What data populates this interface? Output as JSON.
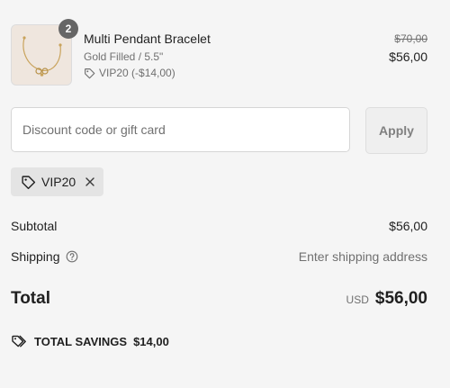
{
  "product": {
    "quantity": "2",
    "name": "Multi Pendant Bracelet",
    "variant": "Gold Filled / 5.5\"",
    "discount_line": "VIP20 (-$14,00)",
    "original_price": "$70,00",
    "price": "$56,00"
  },
  "discount": {
    "placeholder": "Discount code or gift card",
    "apply_label": "Apply",
    "applied_code": "VIP20"
  },
  "summary": {
    "subtotal_label": "Subtotal",
    "subtotal_value": "$56,00",
    "shipping_label": "Shipping",
    "shipping_value": "Enter shipping address",
    "total_label": "Total",
    "currency": "USD",
    "total_value": "$56,00",
    "savings_label": "TOTAL SAVINGS",
    "savings_value": "$14,00"
  },
  "icons": {
    "discount_tag": "tag-icon",
    "remove_code": "close-icon",
    "shipping_help": "question-circle-icon",
    "savings": "double-tag-icon"
  },
  "colors": {
    "background": "#f5f5f5",
    "text": "#1f1f1f",
    "muted_text": "#707070",
    "badge": "#666666",
    "chip": "#e4e4e4",
    "button_bg": "#efefef"
  }
}
